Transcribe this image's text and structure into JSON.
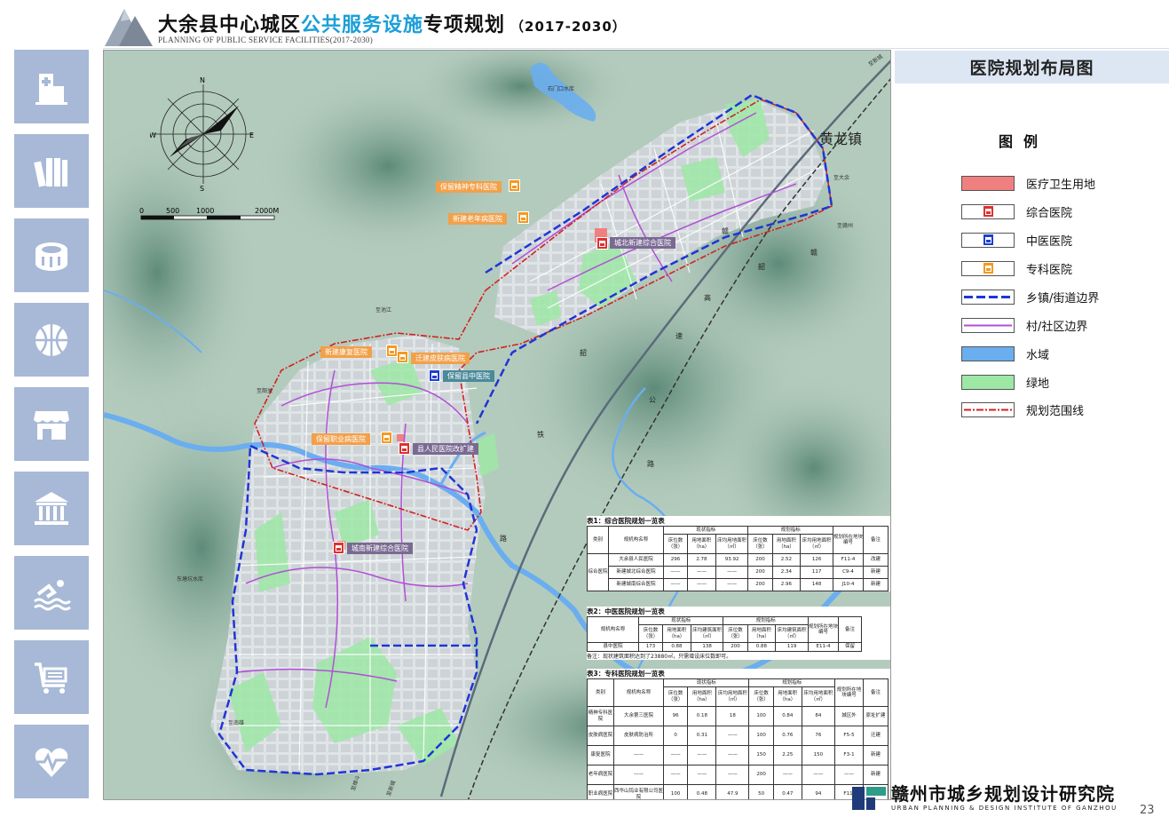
{
  "header": {
    "title_prefix": "大余县中心城区",
    "title_accent": "公共服务设施",
    "title_suffix": "专项规划",
    "years": "（2017-2030）",
    "subtitle": "PLANNING OF PUBLIC SERVICE FACILITIES(2017-2030)"
  },
  "sidebar": {
    "items": [
      {
        "icon": "hospital-icon"
      },
      {
        "icon": "books-icon"
      },
      {
        "icon": "stadium-icon"
      },
      {
        "icon": "basketball-icon"
      },
      {
        "icon": "shop-icon"
      },
      {
        "icon": "museum-icon"
      },
      {
        "icon": "swimming-icon"
      },
      {
        "icon": "cart-icon"
      },
      {
        "icon": "heart-pulse-icon"
      }
    ]
  },
  "map": {
    "compass": {
      "n": "N",
      "s": "S",
      "e": "E",
      "w": "W"
    },
    "scale": {
      "t0": "0",
      "t1": "500",
      "t2": "1000",
      "t3": "2000M"
    },
    "town_label": "黄龙镇",
    "reservoirs": {
      "shikou": "石门口水库",
      "dongtang": "东塘坑水库"
    },
    "highway_chars": [
      "赣",
      "韶",
      "高",
      "速",
      "公",
      "路"
    ],
    "rail_chars": [
      "赣",
      "韶",
      "铁",
      "路"
    ],
    "road_labels": [
      "至新城",
      "至大余",
      "至赣州",
      "至池江",
      "至韶关",
      "至南雄",
      "至樟斗",
      "至新城"
    ],
    "facilities": {
      "baoliu_jingshen": "保留精神专科医院",
      "xinjian_laonian": "新建老年病医院",
      "chengbei": "城北新建综合医院",
      "xinjian_kangfu": "新建康复医院",
      "qianjian_pifu": "迁建皮肤病医院",
      "baoliu_zhongyi": "保留县中医院",
      "baoliu_zhiye": "保留职业病医院",
      "renmin_gaikuo": "县人民医院改扩建",
      "chengnan": "城南新建综合医院"
    }
  },
  "table1": {
    "title": "表1：综合医院规划一览表",
    "h_category": "类别",
    "h_name": "规机构名称",
    "h_current": "现状指标",
    "h_planned": "规划指标",
    "h_beds": "床位数（张）",
    "h_area": "用地面积（ha）",
    "h_per_bed": "床均用地面积（㎡）",
    "h_plot": "规划所在地块编号",
    "h_note": "备注",
    "category": "综合医院",
    "rows": [
      {
        "name": "大余县人民医院",
        "c_beds": "296",
        "c_area": "2.78",
        "c_per": "93.92",
        "p_beds": "200",
        "p_area": "2.52",
        "p_per": "126",
        "plot": "F11-4",
        "note": "改建"
      },
      {
        "name": "新建城北综合医院",
        "c_beds": "——",
        "c_area": "——",
        "c_per": "——",
        "p_beds": "200",
        "p_area": "2.34",
        "p_per": "117",
        "plot": "C9-4",
        "note": "新建"
      },
      {
        "name": "新建城南综合医院",
        "c_beds": "——",
        "c_area": "——",
        "c_per": "——",
        "p_beds": "200",
        "p_area": "2.96",
        "p_per": "148",
        "plot": "J10-4",
        "note": "新建"
      }
    ]
  },
  "table2": {
    "title": "表2：中医医院规划一览表",
    "h_name": "规机构名称",
    "h_current": "现状指标",
    "h_planned": "规划指标",
    "h_beds": "床位数（张）",
    "h_area": "用地面积（ha）",
    "h_per_bed": "床均建筑面积（㎡）",
    "h_plot": "规划所在地块编号",
    "h_note": "备注",
    "row": {
      "name": "县中医院",
      "c_beds": "173",
      "c_area": "0.88",
      "c_per": "138",
      "p_beds": "200",
      "p_area": "0.88",
      "p_per": "119",
      "plot": "E11-4",
      "note": "保留"
    },
    "note": "备注：现状建筑面积达到了23880㎡，只需增设床位数即可。"
  },
  "table3": {
    "title": "表3：专科医院规划一览表",
    "h_category": "类别",
    "h_name": "规机构名称",
    "h_current": "现状指标",
    "h_planned": "规划指标",
    "h_beds": "床位数（张）",
    "h_area": "用地面积（ha）",
    "h_per_bed": "床均用地面积（㎡）",
    "h_plot": "规划所在地块编号",
    "h_note": "备注",
    "rows": [
      {
        "cat": "精神专科医院",
        "name": "大余第三医院",
        "c_beds": "96",
        "c_area": "0.18",
        "c_per": "18",
        "p_beds": "100",
        "p_area": "0.84",
        "p_per": "84",
        "plot": "城区外",
        "note": "原址扩建"
      },
      {
        "cat": "皮肤病医院",
        "name": "皮肤病防治所",
        "c_beds": "0",
        "c_area": "0.31",
        "c_per": "——",
        "p_beds": "100",
        "p_area": "0.76",
        "p_per": "76",
        "plot": "F5-5",
        "note": "迁建"
      },
      {
        "cat": "康复医院",
        "name": "——",
        "c_beds": "——",
        "c_area": "——",
        "c_per": "——",
        "p_beds": "150",
        "p_area": "2.25",
        "p_per": "150",
        "plot": "F3-1",
        "note": "新建"
      },
      {
        "cat": "老年病医院",
        "name": "——",
        "c_beds": "——",
        "c_area": "——",
        "c_per": "——",
        "p_beds": "200",
        "p_area": "——",
        "p_per": "——",
        "plot": "——",
        "note": "新建"
      },
      {
        "cat": "职业病医院",
        "name": "西华山钨业有限公司医院",
        "c_beds": "100",
        "c_area": "0.48",
        "c_per": "47.9",
        "p_beds": "50",
        "p_area": "0.47",
        "p_per": "94",
        "plot": "F11-",
        "note": ""
      }
    ]
  },
  "right_panel": {
    "title": "医院规划布局图",
    "legend_heading": "图例",
    "legend": [
      {
        "label": "医疗卫生用地",
        "swatch": "land",
        "color": "#f08080"
      },
      {
        "label": "综合医院",
        "swatch": "marker",
        "color": "#e03030"
      },
      {
        "label": "中医医院",
        "swatch": "marker",
        "color": "#1d3fd2"
      },
      {
        "label": "专科医院",
        "swatch": "marker",
        "color": "#f39a20"
      },
      {
        "label": "乡镇/街道边界",
        "swatch": "dash-blue",
        "color": "#1f35d6"
      },
      {
        "label": "村/社区边界",
        "swatch": "line-purple",
        "color": "#b14fd6"
      },
      {
        "label": "水域",
        "swatch": "fill",
        "color": "#6aaef0"
      },
      {
        "label": "绿地",
        "swatch": "fill",
        "color": "#9ee8a6"
      },
      {
        "label": "规划范围线",
        "swatch": "dashdot-red",
        "color": "#d42020"
      }
    ]
  },
  "footer": {
    "org_name": "赣州市城乡规划设计研究院",
    "org_en": "URBAN PLANNING & DESIGN INSTITUTE OF GANZHOU",
    "page_number": "23"
  }
}
